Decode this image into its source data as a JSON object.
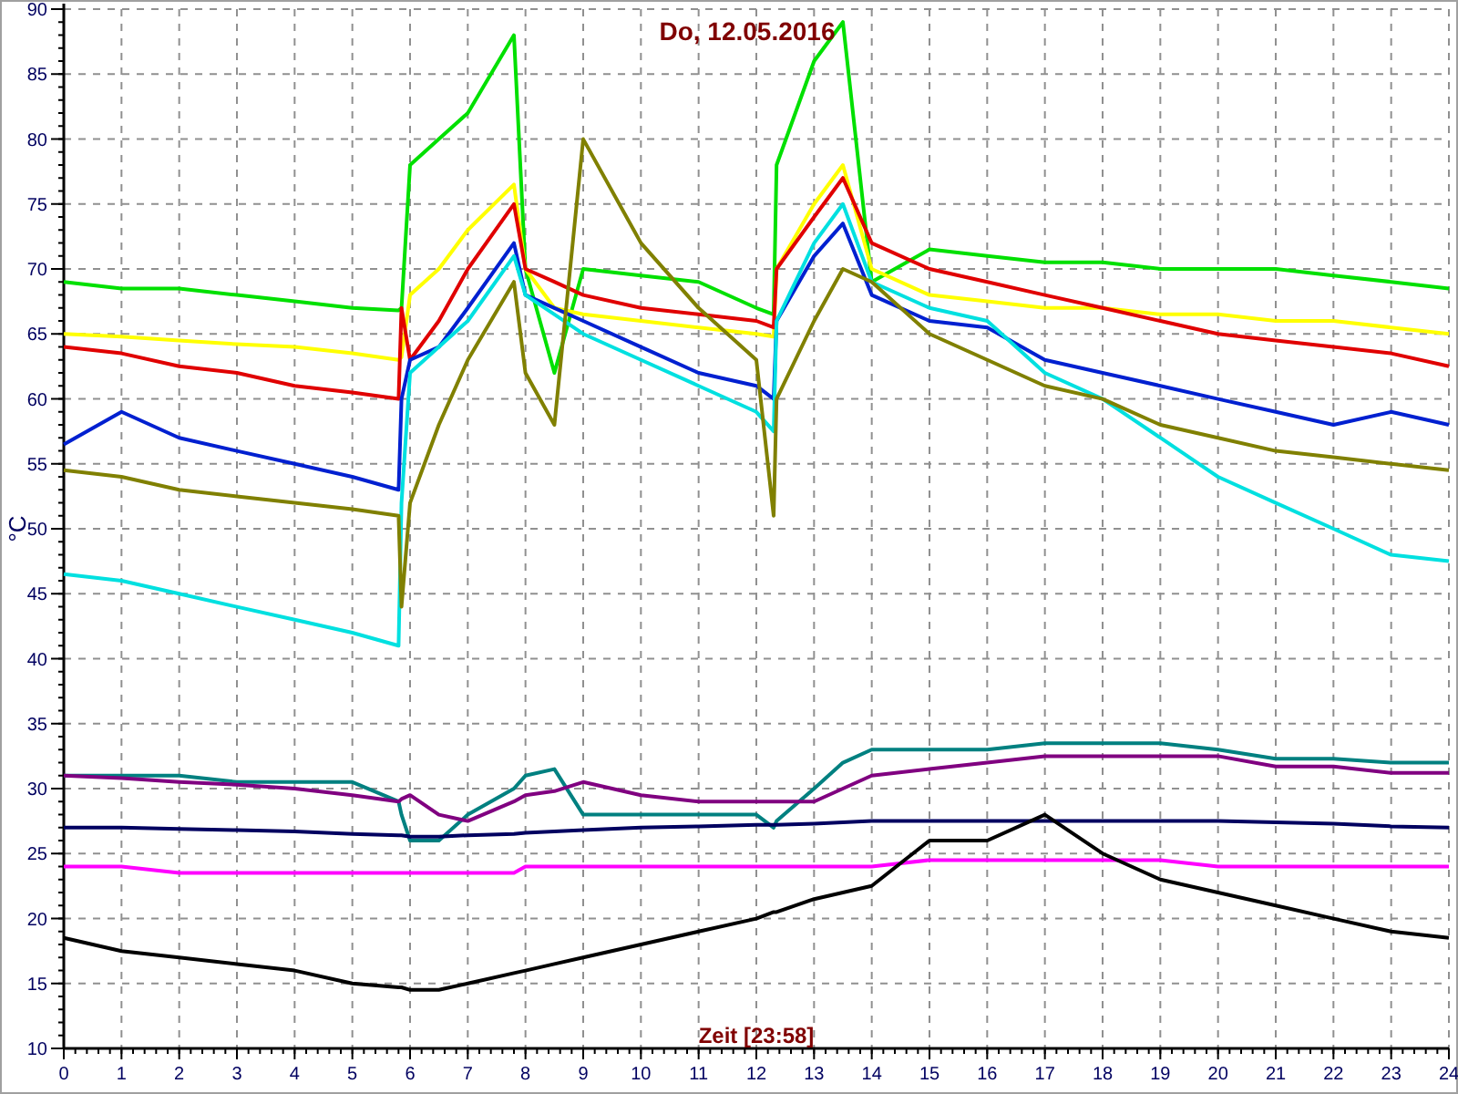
{
  "chart_data": {
    "type": "line",
    "grid": true,
    "title": "Do, 12.05.2016",
    "xlabel": "Zeit [23:58]",
    "ylabel": "°C",
    "xlim": [
      0,
      24
    ],
    "ylim": [
      10,
      90
    ],
    "xticks": [
      0,
      1,
      2,
      3,
      4,
      5,
      6,
      7,
      8,
      9,
      10,
      11,
      12,
      13,
      14,
      15,
      16,
      17,
      18,
      19,
      20,
      21,
      22,
      23,
      24
    ],
    "yticks": [
      10,
      15,
      20,
      25,
      30,
      35,
      40,
      45,
      50,
      55,
      60,
      65,
      70,
      75,
      80,
      85,
      90
    ],
    "x": [
      0,
      1,
      2,
      3,
      4,
      5,
      5.8,
      5.85,
      6,
      6.5,
      7,
      7.8,
      8,
      8.5,
      9,
      10,
      11,
      12,
      12.3,
      12.35,
      13,
      13.5,
      14,
      15,
      16,
      17,
      18,
      19,
      20,
      21,
      22,
      23,
      24
    ],
    "series": [
      {
        "color": "#00e000",
        "values": [
          69,
          68.5,
          68.5,
          68,
          67.5,
          67,
          66.8,
          67,
          78,
          80,
          82,
          88,
          70,
          62,
          70,
          69.5,
          69,
          67,
          66.5,
          78,
          86,
          89,
          69,
          71.5,
          71,
          70.5,
          70.5,
          70,
          70,
          70,
          69.5,
          69,
          68.5
        ]
      },
      {
        "color": "#ffff00",
        "values": [
          65,
          64.8,
          64.5,
          64.2,
          64,
          63.5,
          63,
          63.2,
          68,
          70,
          73,
          76.5,
          70,
          67,
          66.5,
          66,
          65.5,
          65,
          64.8,
          70,
          75,
          78,
          70,
          68,
          67.5,
          67,
          67,
          66.5,
          66.5,
          66,
          66,
          65.5,
          65
        ]
      },
      {
        "color": "#e00000",
        "values": [
          64,
          63.5,
          62.5,
          62,
          61,
          60.5,
          60,
          67,
          63,
          66,
          70,
          75,
          70,
          69,
          68,
          67,
          66.5,
          66,
          65.5,
          70,
          74,
          77,
          72,
          70,
          69,
          68,
          67,
          66,
          65,
          64.5,
          64,
          63.5,
          62.5
        ]
      },
      {
        "color": "#0020d0",
        "values": [
          56.5,
          59,
          57,
          56,
          55,
          54,
          53,
          60,
          63,
          64,
          67,
          72,
          68,
          67,
          66,
          64,
          62,
          61,
          60,
          66,
          71,
          73.5,
          68,
          66,
          65.5,
          63,
          62,
          61,
          60,
          59,
          58,
          59,
          58
        ]
      },
      {
        "color": "#00e0e0",
        "values": [
          46.5,
          46,
          45,
          44,
          43,
          42,
          41,
          52,
          62,
          64,
          66,
          71,
          68,
          66.5,
          65,
          63,
          61,
          59,
          57.5,
          66,
          72,
          75,
          69,
          67,
          66,
          62,
          60,
          57,
          54,
          52,
          50,
          48,
          47.5
        ]
      },
      {
        "color": "#808000",
        "values": [
          54.5,
          54,
          53,
          52.5,
          52,
          51.5,
          51,
          44,
          52,
          58,
          63,
          69,
          62,
          58,
          80,
          72,
          67,
          63,
          51,
          60,
          66,
          70,
          69,
          65,
          63,
          61,
          60,
          58,
          57,
          56,
          55.5,
          55,
          54.5
        ]
      },
      {
        "color": "#008080",
        "values": [
          31,
          31,
          31,
          30.5,
          30.5,
          30.5,
          29,
          28,
          26,
          26,
          28,
          30,
          31,
          31.5,
          28,
          28,
          28,
          28,
          27,
          27.5,
          30,
          32,
          33,
          33,
          33,
          33.5,
          33.5,
          33.5,
          33,
          32.3,
          32.3,
          32,
          32
        ]
      },
      {
        "color": "#800080",
        "values": [
          31,
          30.8,
          30.5,
          30.3,
          30,
          29.5,
          29,
          29.2,
          29.5,
          28,
          27.5,
          29,
          29.5,
          29.8,
          30.5,
          29.5,
          29,
          29,
          29,
          29,
          29,
          30,
          31,
          31.5,
          32,
          32.5,
          32.5,
          32.5,
          32.5,
          31.7,
          31.7,
          31.2,
          31.2
        ]
      },
      {
        "color": "#000060",
        "values": [
          27,
          27,
          26.9,
          26.8,
          26.7,
          26.5,
          26.4,
          26.4,
          26.3,
          26.3,
          26.4,
          26.5,
          26.6,
          26.7,
          26.8,
          27,
          27.1,
          27.2,
          27.2,
          27.2,
          27.3,
          27.4,
          27.5,
          27.5,
          27.5,
          27.5,
          27.5,
          27.5,
          27.5,
          27.4,
          27.3,
          27.1,
          27
        ]
      },
      {
        "color": "#ff00ff",
        "values": [
          24,
          24,
          23.5,
          23.5,
          23.5,
          23.5,
          23.5,
          23.5,
          23.5,
          23.5,
          23.5,
          23.5,
          24,
          24,
          24,
          24,
          24,
          24,
          24,
          24,
          24,
          24,
          24,
          24.5,
          24.5,
          24.5,
          24.5,
          24.5,
          24,
          24,
          24,
          24,
          24
        ]
      },
      {
        "color": "#000000",
        "values": [
          18.5,
          17.5,
          17,
          16.5,
          16,
          15,
          14.7,
          14.7,
          14.5,
          14.5,
          15,
          15.8,
          16,
          16.5,
          17,
          18,
          19,
          20,
          20.5,
          20.5,
          21.5,
          22,
          22.5,
          26,
          26,
          28,
          25,
          23,
          22,
          21,
          20,
          19,
          18.5
        ]
      }
    ]
  }
}
